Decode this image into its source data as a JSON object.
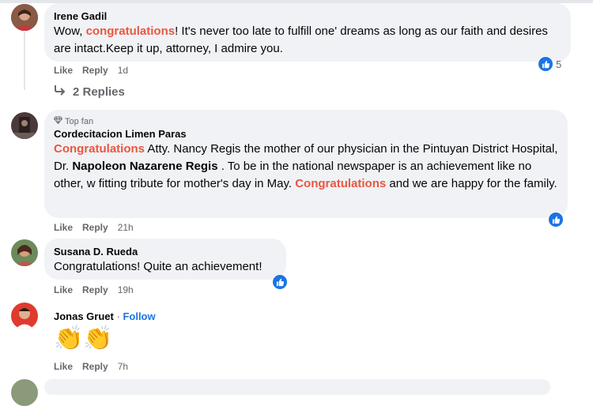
{
  "comments": [
    {
      "author": "Irene Gadil",
      "text_parts": [
        "Wow, ",
        "congratulations",
        "! It's never too late to fulfill one' dreams as long as our faith and desires are intact.Keep it up, attorney, I admire you."
      ],
      "like": "Like",
      "reply": "Reply",
      "time": "1d",
      "reaction_count": "5",
      "replies_label": "2 Replies"
    },
    {
      "badge": "Top fan",
      "author": "Cordecitacion Limen Paras",
      "text_parts": [
        "Congratulations",
        " Atty. Nancy Regis the mother of our physician in the Pintuyan District Hospital, Dr. ",
        "Napoleon Nazarene Regis",
        " . To be in the national newspaper is an achievement like no other, w fitting tribute for mother's day in May. ",
        "Congratulations",
        " and we are happy for the family."
      ],
      "like": "Like",
      "reply": "Reply",
      "time": "21h"
    },
    {
      "author": "Susana D. Rueda",
      "text": "Congratulations! Quite an achievement!",
      "like": "Like",
      "reply": "Reply",
      "time": "19h"
    },
    {
      "author": "Jonas Gruet",
      "follow_separator": "·",
      "follow": "Follow",
      "emoji": "👏👏",
      "like": "Like",
      "reply": "Reply",
      "time": "7h"
    }
  ],
  "colors": {
    "accent": "#1b74e4",
    "highlight": "#e9573f",
    "bubble": "#f0f2f5"
  },
  "icons": [
    "like-icon",
    "reply-arrow-icon",
    "gem-icon"
  ]
}
